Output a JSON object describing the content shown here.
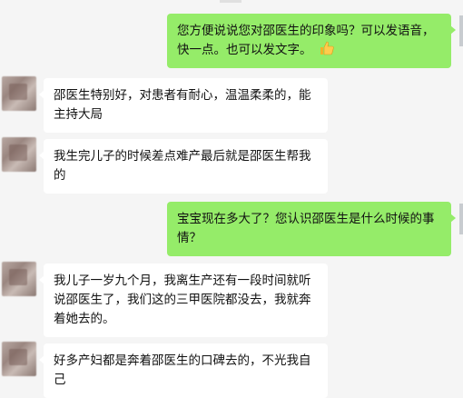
{
  "messages": [
    {
      "id": 1,
      "side": "out",
      "text": "您方便说说您对邵医生的印象吗？可以发语音，快一点。也可以发文字。",
      "emoji": "thumbs-up-emoji"
    },
    {
      "id": 2,
      "side": "in",
      "text": "邵医生特别好，对患者有耐心，温温柔柔的，能主持大局"
    },
    {
      "id": 3,
      "side": "in",
      "text": "我生完儿子的时候差点难产最后就是邵医生帮我的"
    },
    {
      "id": 4,
      "side": "out",
      "text": "宝宝现在多大了？您认识邵医生是什么时候的事情？"
    },
    {
      "id": 5,
      "side": "in",
      "text": "我儿子一岁九个月，我离生产还有一段时间就听说邵医生了，我们这的三甲医院都没去，我就奔着她去的。"
    },
    {
      "id": 6,
      "side": "in",
      "text": "好多产妇都是奔着邵医生的口碑去的，不光我自己"
    }
  ],
  "colors": {
    "outgoing": "#95ec69",
    "incoming": "#ffffff",
    "background": "#f5f5f5"
  }
}
